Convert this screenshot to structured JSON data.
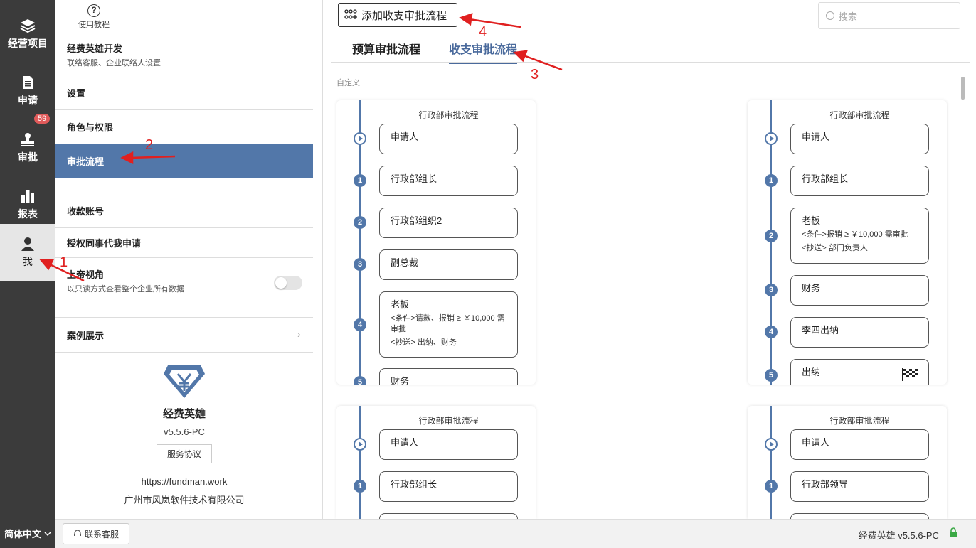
{
  "nav": {
    "items": [
      {
        "label": "经营项目",
        "icon": "layers-icon"
      },
      {
        "label": "申请",
        "icon": "document-icon"
      },
      {
        "label": "审批",
        "icon": "stamp-icon",
        "badge": "59"
      },
      {
        "label": "报表",
        "icon": "bar-chart-icon"
      },
      {
        "label": "我",
        "icon": "user-icon"
      }
    ],
    "language": "简体中文"
  },
  "panel": {
    "help_label": "使用教程",
    "company": {
      "title": "经费英雄开发",
      "subtitle": "联络客服、企业联络人设置"
    },
    "rows": [
      "设置",
      "角色与权限",
      "审批流程",
      "收款账号",
      "授权同事代我申请"
    ],
    "god_view": {
      "title": "上帝视角",
      "subtitle": "以只读方式查看整个企业所有数据"
    },
    "showcase": "案例展示",
    "about": {
      "name": "经费英雄",
      "version": "v5.5.6-PC",
      "agreement": "服务协议",
      "url": "https://fundman.work",
      "company": "广州市风岚软件技术有限公司"
    }
  },
  "main": {
    "add_button": "添加收支审批流程",
    "search_placeholder": "搜索",
    "tabs": [
      "预算审批流程",
      "收支审批流程"
    ],
    "section_label": "自定义",
    "cards": [
      {
        "title": "行政部审批流程",
        "nodes": [
          {
            "step": "",
            "name": "申请人"
          },
          {
            "step": "1",
            "name": "行政部组长"
          },
          {
            "step": "2",
            "name": "行政部组织2"
          },
          {
            "step": "3",
            "name": "副总裁"
          },
          {
            "step": "4",
            "name": "老板",
            "cond": "<条件>请款、报销 ≥ ￥10,000 需审批",
            "cc": "<抄送> 出纳、财务"
          },
          {
            "step": "5",
            "name": "财务"
          }
        ]
      },
      {
        "title": "行政部审批流程",
        "nodes": [
          {
            "step": "",
            "name": "申请人"
          },
          {
            "step": "1",
            "name": "行政部组长"
          },
          {
            "step": "2",
            "name": "老板",
            "cond": "<条件>报销 ≥ ￥10,000 需审批",
            "cc": "<抄送> 部门负责人"
          },
          {
            "step": "3",
            "name": "财务"
          },
          {
            "step": "4",
            "name": "李四出纳"
          },
          {
            "step": "5",
            "name": "出纳"
          }
        ]
      },
      {
        "title": "行政部审批流程",
        "nodes": [
          {
            "step": "",
            "name": "申请人"
          },
          {
            "step": "1",
            "name": "行政部组长"
          }
        ]
      },
      {
        "title": "行政部审批流程",
        "nodes": [
          {
            "step": "",
            "name": "申请人"
          },
          {
            "step": "1",
            "name": "行政部领导"
          }
        ]
      }
    ]
  },
  "bottom": {
    "support": "联系客服",
    "version": "经费英雄 v5.5.6-PC"
  },
  "annotations": [
    "1",
    "2",
    "3",
    "4"
  ],
  "colors": {
    "accent": "#5277a9",
    "nav_bg": "#3b3b3b",
    "annotation": "#e02020",
    "badge": "#e05a5a"
  }
}
